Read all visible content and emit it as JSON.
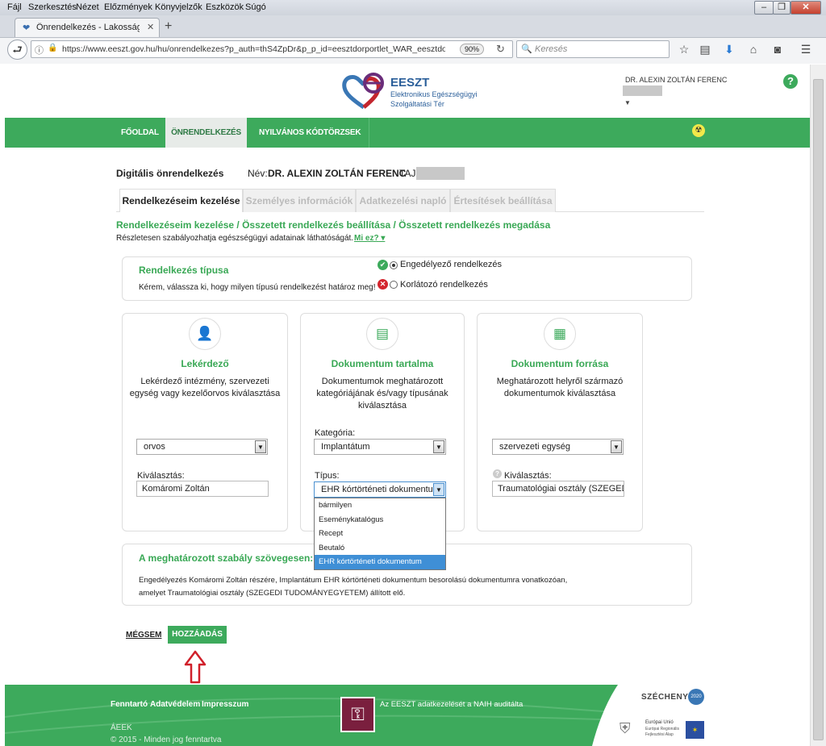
{
  "browser": {
    "menu": [
      "Fájl",
      "Szerkesztés",
      "Nézet",
      "Előzmények",
      "Könyvjelzők",
      "Eszközök",
      "Súgó"
    ],
    "tab_title": "Önrendelkezés - Lakossági P…",
    "url": "https://www.eeszt.gov.hu/hu/onrendelkezes?p_auth=thS4ZpDr&p_p_id=eesztdorportlet_WAR_eesztdorpo",
    "zoom": "90%",
    "search_placeholder": "Keresés"
  },
  "header": {
    "brand": "EESZT",
    "brand_sub1": "Elektronikus Egészségügyi",
    "brand_sub2": "Szolgáltatási Tér",
    "user_name": "DR. ALEXIN ZOLTÁN FERENC",
    "help": "?"
  },
  "nav": {
    "items": [
      "FŐOLDAL",
      "ÖNRENDELKEZÉS",
      "NYILVÁNOS KÓDTÖRZSEK"
    ]
  },
  "info": {
    "title": "Digitális önrendelkezés",
    "name_label": "Név:",
    "name_value": "DR. ALEXIN ZOLTÁN FERENC",
    "taj_label": "TAJ:"
  },
  "subtabs": [
    "Rendelkezéseim kezelése",
    "Személyes információk",
    "Adatkezelési napló",
    "Értesítések beállítása"
  ],
  "breadcrumb": "Rendelkezéseim kezelése / Összetett rendelkezés beállítása / Összetett rendelkezés megadása",
  "description": "Részletesen szabályozhatja egészségügyi adatainak láthatóságát.",
  "more_link": "Mi ez?",
  "type_box": {
    "title": "Rendelkezés típusa",
    "prompt": "Kérem, válassza ki, hogy milyen típusú rendelkezést határoz meg!",
    "option_allow": "Engedélyező rendelkezés",
    "option_restrict": "Korlátozó rendelkezés"
  },
  "columns": [
    {
      "title": "Lekérdező",
      "text": "Lekérdező intézmény, szervezeti egység vagy kezelőorvos kiválasztása"
    },
    {
      "title": "Dokumentum tartalma",
      "text": "Dokumentumok meghatározott kategóriájának és/vagy típusának kiválasztása"
    },
    {
      "title": "Dokumentum forrása",
      "text": "Meghatározott helyről származó dokumentumok kiválasztása"
    }
  ],
  "form": {
    "requester_select": "orvos",
    "requester_label": "Kiválasztás:",
    "requester_value": "Komáromi Zoltán",
    "category_label": "Kategória:",
    "category_value": "Implantátum",
    "type_label": "Típus:",
    "type_value": "EHR kórtörténeti dokumentum",
    "source_select": "szervezeti egység",
    "source_label": "Kiválasztás:",
    "source_value": "Traumatológiai osztály (SZEGEDI T"
  },
  "dropdown_options": [
    "bármilyen",
    "Eseménykatalógus",
    "Recept",
    "Beutaló",
    "EHR kórtörténeti dokumentum"
  ],
  "rule_box": {
    "title": "A meghatározott szabály szövegesen:",
    "line1": "Engedélyezés Komáromi Zoltán részére, Implantátum EHR kórtörténeti dokumentum besorolású dokumentumra vonatkozóan,",
    "line2": "amelyet Traumatológiai osztály (SZEGEDI TUDOMÁNYEGYETEM) állított elő."
  },
  "actions": {
    "cancel": "MÉGSEM",
    "add": "HOZZÁADÁS"
  },
  "footer": {
    "links": [
      "Fenntartó",
      "Adatvédelem",
      "Impresszum"
    ],
    "naih": "Az EESZT adatkezelését a NAIH auditálta",
    "aeek": "ÁEEK",
    "copyright": "© 2015 - Minden jog fenntartva",
    "szechenyi": "SZÉCHENYI",
    "szechenyi_year": "2020",
    "eu_text1": "Európai Unió",
    "eu_text2": "Európai Regionális",
    "eu_text3": "Fejlesztési Alap"
  },
  "colors": {
    "green": "#3daa5c",
    "accent_arrow": "#d0202a"
  }
}
